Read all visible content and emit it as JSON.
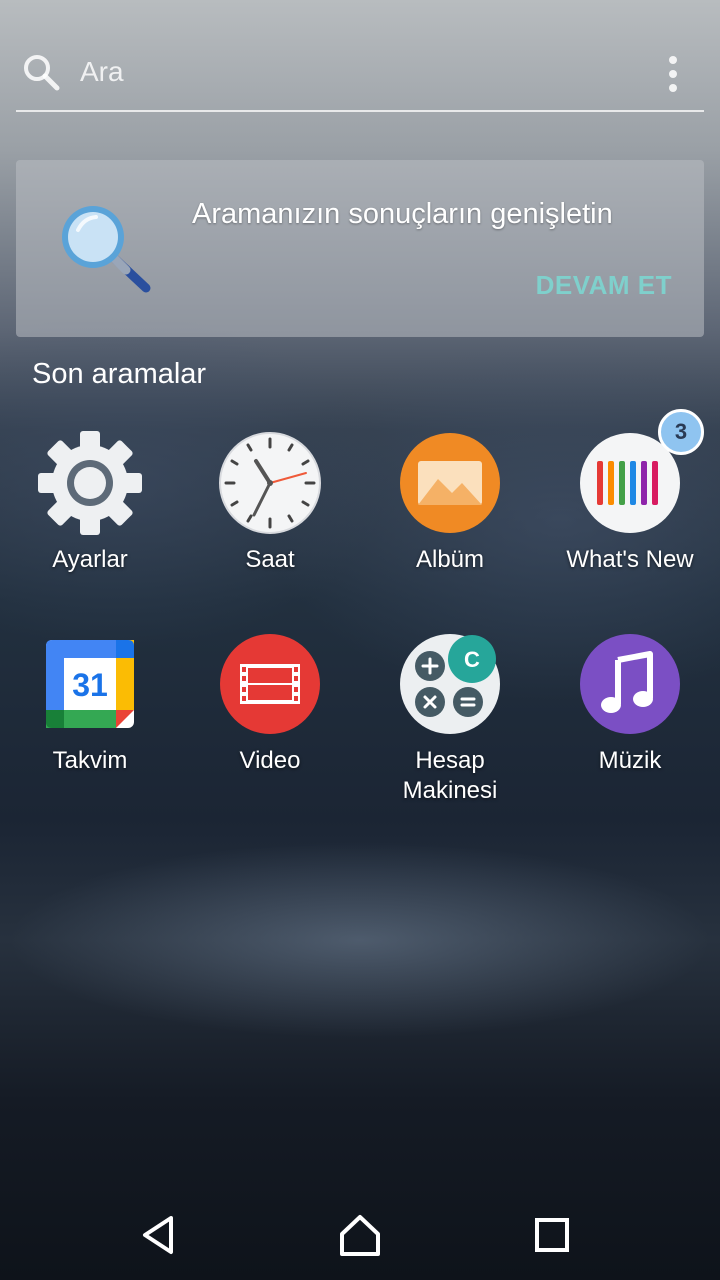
{
  "search": {
    "placeholder": "Ara"
  },
  "promo": {
    "text": "Aramanızın sonuçların genişletin",
    "button_label": "DEVAM ET"
  },
  "section": {
    "title": "Son aramalar"
  },
  "apps": [
    {
      "label": "Ayarlar",
      "icon": "gear-icon"
    },
    {
      "label": "Saat",
      "icon": "clock-icon"
    },
    {
      "label": "Albüm",
      "icon": "album-icon"
    },
    {
      "label": "What's New",
      "icon": "whats-new-icon",
      "badge": "3"
    },
    {
      "label": "Takvim",
      "icon": "calendar-icon",
      "icon_text": "31"
    },
    {
      "label": "Video",
      "icon": "video-icon"
    },
    {
      "label": "Hesap\nMakinesi",
      "icon": "calculator-icon",
      "icon_text": "C"
    },
    {
      "label": "Müzik",
      "icon": "music-icon"
    }
  ],
  "colors": {
    "accent": "#7fd0cc",
    "badge": "#8fc4f0",
    "album": "#f08a24",
    "video": "#e53935",
    "music": "#7b4fc4",
    "calendar_blue": "#4285f4"
  },
  "nav": {
    "back_icon": "back-icon",
    "home_icon": "home-icon",
    "recents_icon": "recents-icon"
  }
}
